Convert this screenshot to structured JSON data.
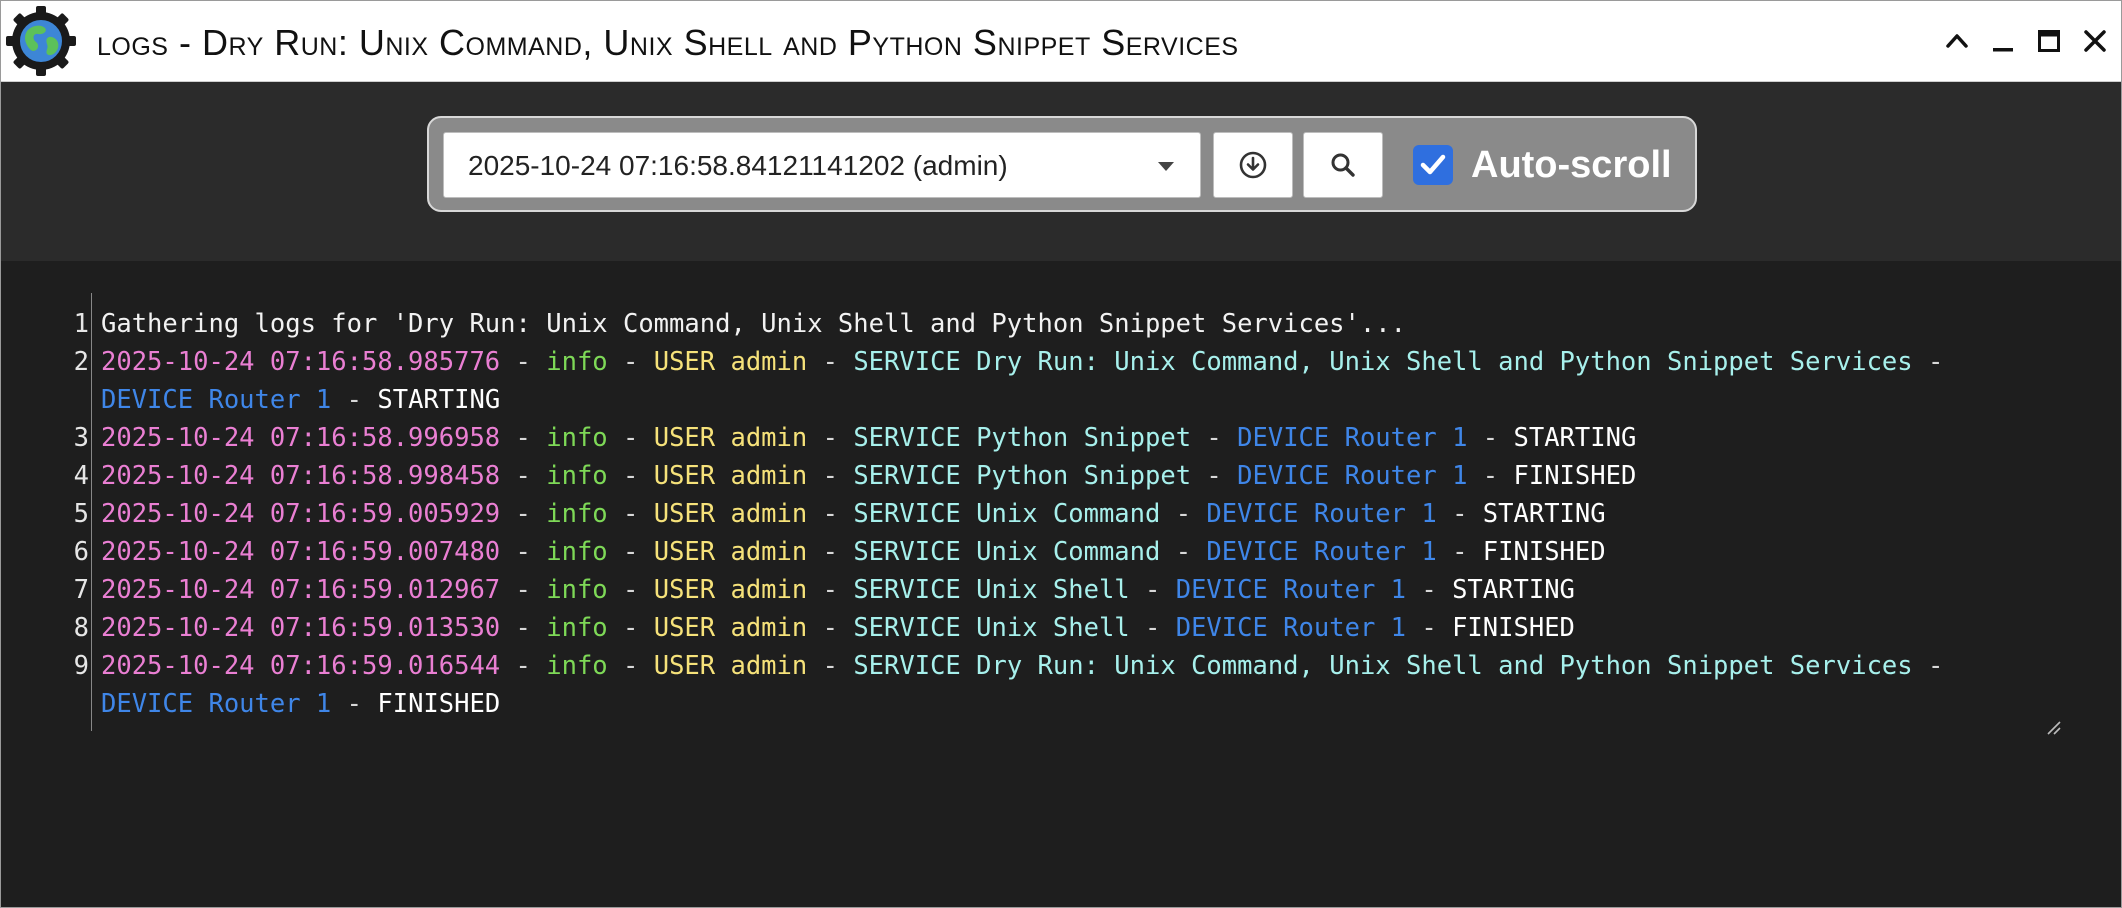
{
  "window": {
    "title": "logs - Dry Run: Unix Command, Unix Shell and Python Snippet Services",
    "icons": {
      "logo": "gear-globe-icon",
      "collapse": "chevron-up-icon",
      "minimize": "minimize-icon",
      "maximize": "maximize-icon",
      "close": "close-icon"
    }
  },
  "toolbar": {
    "runtime_select": {
      "value": "2025-10-24 07:16:58.84121141202 (admin)"
    },
    "download_icon": "download-circle-icon",
    "search_icon": "search-icon",
    "autoscroll": {
      "checked": true,
      "label": "Auto-scroll"
    }
  },
  "colors": {
    "timestamp": "#ea7fd3",
    "info": "#7ed957",
    "user": "#f6e27a",
    "service": "#a7f0ec",
    "device": "#3f86e8",
    "checkbox": "#2f6fdf"
  },
  "logs": [
    {
      "n": "1",
      "text": "Gathering logs for 'Dry Run: Unix Command, Unix Shell and Python Snippet Services'..."
    },
    {
      "n": "2",
      "ts": "2025-10-24 07:16:58.985776",
      "level": "info",
      "user": "USER admin",
      "service": "SERVICE Dry Run: Unix Command, Unix Shell and Python Snippet Services",
      "device": "DEVICE Router 1",
      "status": "STARTING"
    },
    {
      "n": "3",
      "ts": "2025-10-24 07:16:58.996958",
      "level": "info",
      "user": "USER admin",
      "service": "SERVICE Python Snippet",
      "device": "DEVICE Router 1",
      "status": "STARTING"
    },
    {
      "n": "4",
      "ts": "2025-10-24 07:16:58.998458",
      "level": "info",
      "user": "USER admin",
      "service": "SERVICE Python Snippet",
      "device": "DEVICE Router 1",
      "status": "FINISHED"
    },
    {
      "n": "5",
      "ts": "2025-10-24 07:16:59.005929",
      "level": "info",
      "user": "USER admin",
      "service": "SERVICE Unix Command",
      "device": "DEVICE Router 1",
      "status": "STARTING"
    },
    {
      "n": "6",
      "ts": "2025-10-24 07:16:59.007480",
      "level": "info",
      "user": "USER admin",
      "service": "SERVICE Unix Command",
      "device": "DEVICE Router 1",
      "status": "FINISHED"
    },
    {
      "n": "7",
      "ts": "2025-10-24 07:16:59.012967",
      "level": "info",
      "user": "USER admin",
      "service": "SERVICE Unix Shell",
      "device": "DEVICE Router 1",
      "status": "STARTING"
    },
    {
      "n": "8",
      "ts": "2025-10-24 07:16:59.013530",
      "level": "info",
      "user": "USER admin",
      "service": "SERVICE Unix Shell",
      "device": "DEVICE Router 1",
      "status": "FINISHED"
    },
    {
      "n": "9",
      "ts": "2025-10-24 07:16:59.016544",
      "level": "info",
      "user": "USER admin",
      "service": "SERVICE Dry Run: Unix Command, Unix Shell and Python Snippet Services",
      "device": "DEVICE Router 1",
      "status": "FINISHED"
    }
  ]
}
